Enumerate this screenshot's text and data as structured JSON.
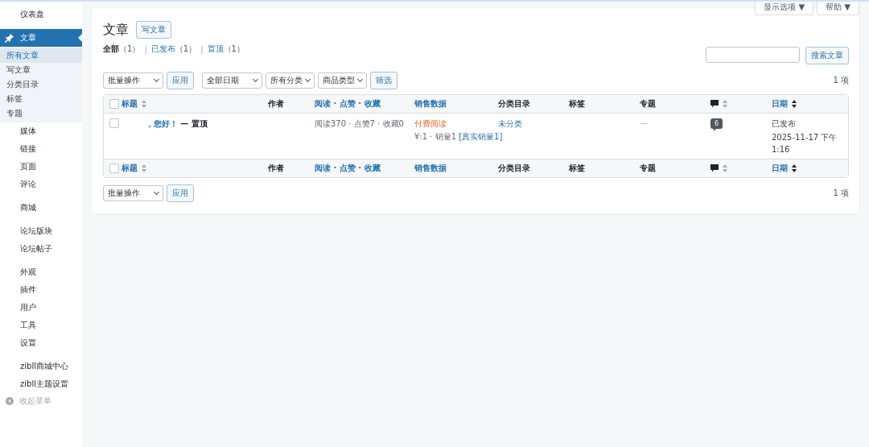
{
  "sidebar": {
    "groups": [
      {
        "items": [
          {
            "label": "仪表盘",
            "selected": false
          }
        ]
      },
      {
        "items": [
          {
            "label": "文章",
            "selected": true,
            "kind": "pin",
            "children": [
              {
                "label": "所有文章",
                "selected": true
              },
              {
                "label": "写文章",
                "selected": false
              },
              {
                "label": "分类目录",
                "selected": false
              },
              {
                "label": "标签",
                "selected": false
              },
              {
                "label": "专题",
                "selected": false
              }
            ]
          },
          {
            "label": "媒体",
            "selected": false
          },
          {
            "label": "链接",
            "selected": false
          },
          {
            "label": "页面",
            "selected": false
          },
          {
            "label": "评论",
            "selected": false
          }
        ]
      },
      {
        "items": [
          {
            "label": "商城",
            "selected": false
          }
        ]
      },
      {
        "items": [
          {
            "label": "论坛版块",
            "selected": false
          },
          {
            "label": "论坛帖子",
            "selected": false
          }
        ]
      },
      {
        "items": [
          {
            "label": "外观",
            "selected": false
          },
          {
            "label": "插件",
            "selected": false
          },
          {
            "label": "用户",
            "selected": false
          },
          {
            "label": "工具",
            "selected": false
          },
          {
            "label": "设置",
            "selected": false
          }
        ]
      },
      {
        "items": [
          {
            "label": "zibll商城中心",
            "selected": false
          },
          {
            "label": "zibll主题设置",
            "selected": false
          }
        ]
      }
    ],
    "collapse": "收起菜单"
  },
  "top_buttons": [
    "显示选项 ▼",
    "帮助 ▼"
  ],
  "page": {
    "title": "文章",
    "add_button": "写文章"
  },
  "filters": [
    {
      "label": "全部",
      "count": "（1）",
      "selected": true
    },
    {
      "separator": "|",
      "label": "已发布",
      "count": "（1）",
      "selected": false
    },
    {
      "separator": "|",
      "label": "置顶",
      "count": "（1）",
      "selected": false
    }
  ],
  "search": {
    "button": "搜索文章"
  },
  "toolbar": {
    "bulk": "批量操作",
    "apply": "应用",
    "dropdowns": [
      "全部日期",
      "所有分类",
      "商品类型"
    ],
    "filter": "筛选",
    "count": "1 项"
  },
  "table": {
    "header": {
      "checked": false,
      "columns": [
        {
          "label": "标题",
          "kind": "text",
          "link": true,
          "sorted": false
        },
        {
          "label": "作者",
          "kind": "text",
          "link": false
        },
        {
          "label": "阅读 · 点赞 · 收藏",
          "kind": "text",
          "link": true
        },
        {
          "label": "销售数据",
          "kind": "text",
          "link": true
        },
        {
          "label": "分类目录",
          "kind": "text",
          "link": false
        },
        {
          "label": "标签",
          "kind": "text",
          "link": false
        },
        {
          "label": "专题",
          "kind": "text",
          "link": false
        },
        {
          "kind": "comment-icon",
          "sorted": false
        },
        {
          "label": "日期",
          "kind": "text",
          "link": true,
          "sorted": true
        }
      ]
    },
    "footer": {
      "checked": false,
      "columns": [
        {
          "label": "标题",
          "kind": "text",
          "link": true,
          "sorted": false
        },
        {
          "label": "作者",
          "kind": "text",
          "link": false
        },
        {
          "label": "阅读 · 点赞 · 收藏",
          "kind": "text",
          "link": true
        },
        {
          "label": "销售数据",
          "kind": "text",
          "link": true
        },
        {
          "label": "分类目录",
          "kind": "text",
          "link": false
        },
        {
          "label": "标签",
          "kind": "text",
          "link": false
        },
        {
          "label": "专题",
          "kind": "text",
          "link": false
        },
        {
          "kind": "comment-icon",
          "sorted": false
        },
        {
          "label": "日期",
          "kind": "text",
          "link": true,
          "sorted": true
        }
      ]
    },
    "rows": [
      {
        "checked": false,
        "title": "，您好！",
        "state": "— 置顶",
        "stats": "阅读370 · 点赞7 · 收藏0",
        "sale_type": "付费阅读",
        "sale_info": "¥:1 · 销量1",
        "sale_link": "[真实销量1]",
        "category": "未分类",
        "topic": "—",
        "comments": "6",
        "status": "已发布",
        "date": "2025-11-17 下午 1:16"
      }
    ]
  },
  "bottom_toolbar": {
    "bulk": "批量操作",
    "apply": "应用",
    "count": "1 项"
  }
}
